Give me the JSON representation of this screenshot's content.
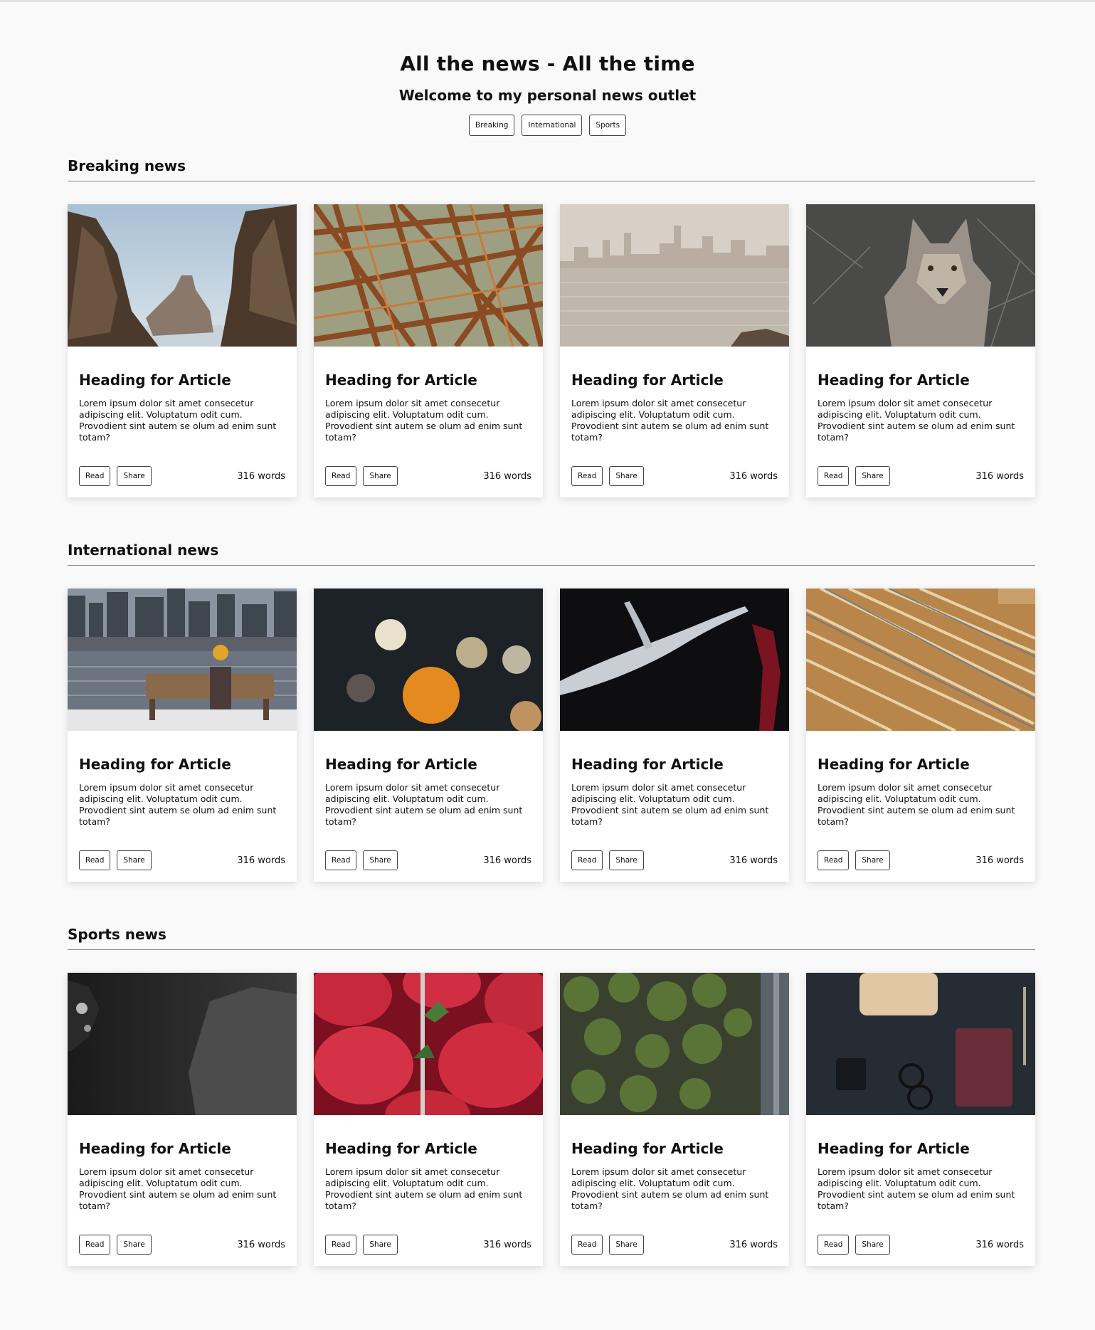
{
  "header": {
    "title": "All the news - All the time",
    "subtitle": "Welcome to my personal news outlet",
    "nav": [
      "Breaking",
      "International",
      "Sports"
    ]
  },
  "card_text": {
    "heading": "Heading for Article",
    "body": "Lorem ipsum dolor sit amet consecetur adipiscing elit. Voluptatum odit cum. Provodient sint autem se olum ad enim sunt totam?",
    "read_label": "Read",
    "share_label": "Share",
    "word_count": "316 words"
  },
  "sections": [
    {
      "title": "Breaking news",
      "images": [
        "rock-formations-sea",
        "steel-bridge-structure",
        "foggy-city-skyline-water",
        "coyote-in-brush"
      ]
    },
    {
      "title": "International news",
      "images": [
        "person-on-bench-city-waterfront",
        "bokeh-lights-night",
        "antler-dark-background",
        "wooden-rulers-pencils"
      ]
    },
    {
      "title": "Sports news",
      "images": [
        "diver-underwater-rocks",
        "strawberries-closeup",
        "mossy-forest-ground",
        "desk-flatlay-glasses-notebook"
      ]
    }
  ]
}
